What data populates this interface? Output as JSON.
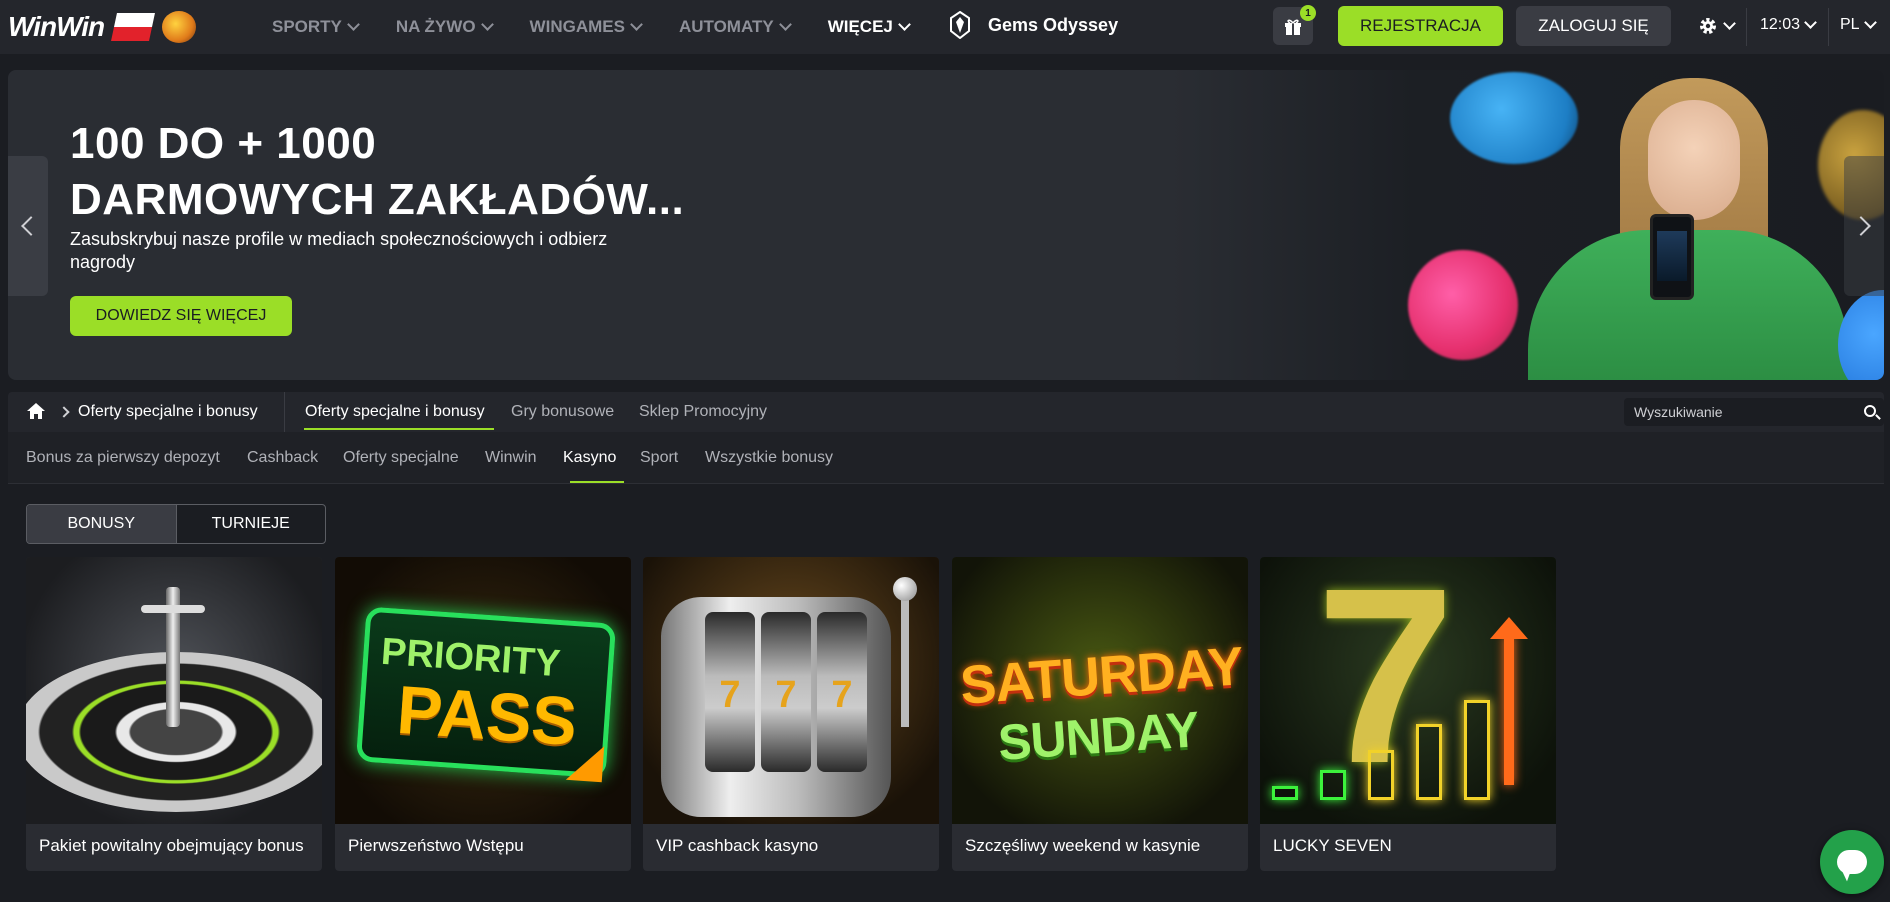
{
  "topnav": {
    "logo": "WinWin",
    "items": [
      {
        "label": "SPORTY"
      },
      {
        "label": "NA ŻYWO"
      },
      {
        "label": "WINGAMES"
      },
      {
        "label": "AUTOMATY"
      },
      {
        "label": "WIĘCEJ"
      }
    ],
    "game": "Gems Odyssey",
    "gift_badge": "1",
    "register": "REJESTRACJA",
    "login": "ZALOGUJ SIĘ",
    "time": "12:03",
    "lang": "PL"
  },
  "banner": {
    "title_line1": "100 DO + 1000",
    "title_line2": "DARMOWYCH ZAKŁADÓW...",
    "subtitle": "Zasubskrybuj nasze profile w mediach społecznościowych i odbierz nagrody",
    "cta": "DOWIEDZ SIĘ WIĘCEJ"
  },
  "breadcrumb": {
    "current": "Oferty specjalne i bonusy"
  },
  "tabs": [
    {
      "label": "Oferty specjalne i bonusy"
    },
    {
      "label": "Gry bonusowe"
    },
    {
      "label": "Sklep Promocyjny"
    }
  ],
  "search": {
    "placeholder": "Wyszukiwanie"
  },
  "subtabs": [
    {
      "label": "Bonus za pierwszy depozyt"
    },
    {
      "label": "Cashback"
    },
    {
      "label": "Oferty specjalne"
    },
    {
      "label": "Winwin"
    },
    {
      "label": "Kasyno"
    },
    {
      "label": "Sport"
    },
    {
      "label": "Wszystkie bonusy"
    }
  ],
  "toggle": {
    "bonusy": "BONUSY",
    "turnieje": "TURNIEJE"
  },
  "cards": [
    {
      "label": "Pakiet powitalny obejmujący bonus"
    },
    {
      "label": "Pierwszeństwo Wstępu",
      "art1": "PRIORITY",
      "art2": "PASS"
    },
    {
      "label": "VIP cashback kasyno",
      "reel": "7"
    },
    {
      "label": "Szczęśliwy weekend w kasynie",
      "art1": "SATURDAY",
      "art2": "SUNDAY"
    },
    {
      "label": "LUCKY SEVEN",
      "art1": "7"
    }
  ],
  "colors": {
    "accent": "#9bde27",
    "nav_bg": "#24262c",
    "page_bg": "#1b1d22"
  }
}
